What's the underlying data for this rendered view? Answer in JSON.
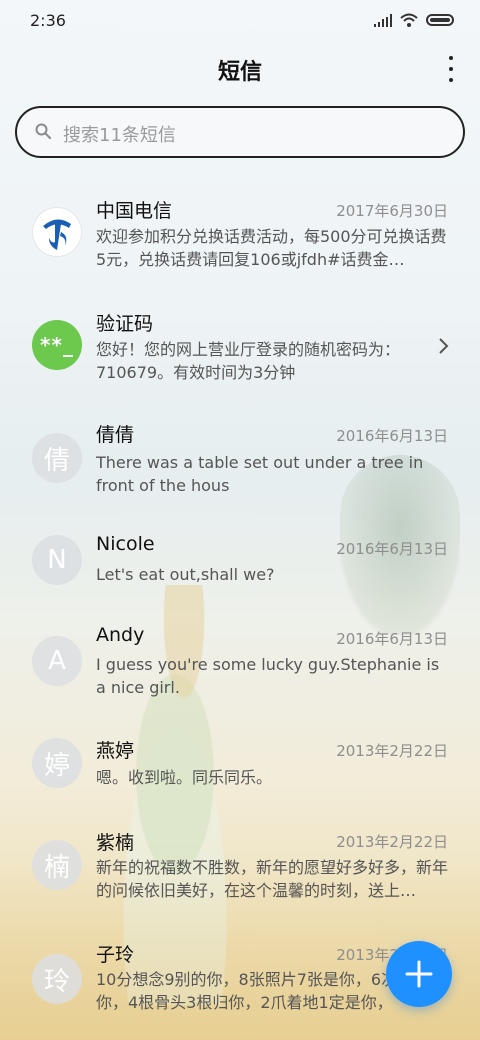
{
  "status_bar": {
    "time": "2:36"
  },
  "header": {
    "title": "短信"
  },
  "search": {
    "placeholder": "搜索11条短信"
  },
  "messages": [
    {
      "sender": "中国电信",
      "date": "2017年6月30日",
      "preview": "欢迎参加积分兑换话费活动，每500分可兑换话费5元，兑换话费请回复106或jfdh#话费金…",
      "avatar": "",
      "avatar_type": "china-telecom-logo-icon"
    },
    {
      "sender": "验证码",
      "date": "",
      "preview": "您好！您的网上营业厅登录的随机密码为：710679。有效时间为3分钟",
      "avatar": "**_",
      "avatar_type": "verification-code-icon"
    },
    {
      "sender": "倩倩",
      "date": "2016年6月13日",
      "preview": "There was a table set out under a tree in front of the hous",
      "avatar": "倩"
    },
    {
      "sender": "Nicole",
      "date": "2016年6月13日",
      "preview": "Let's eat out,shall we?",
      "avatar": "N"
    },
    {
      "sender": "Andy",
      "date": "2016年6月13日",
      "preview": "I guess you're some lucky guy.Stephanie is a nice girl.",
      "avatar": "A"
    },
    {
      "sender": "燕婷",
      "date": "2013年2月22日",
      "preview": "嗯。收到啦。同乐同乐。",
      "avatar": "婷"
    },
    {
      "sender": "紫楠",
      "date": "2013年2月22日",
      "preview": "新年的祝福数不胜数，新年的愿望好多好多，新年的问候依旧美好，在这个温馨的时刻，送上…",
      "avatar": "楠"
    },
    {
      "sender": "子玲",
      "date": "2013年2月22日",
      "preview": "10分想念9别的你，8张照片7张是你，6次…只像你，4根骨头3根归你，2爪着地1定是你，",
      "avatar": "玲"
    }
  ],
  "colors": {
    "accent": "#1e90ff",
    "verify_green": "#6cc94d"
  }
}
